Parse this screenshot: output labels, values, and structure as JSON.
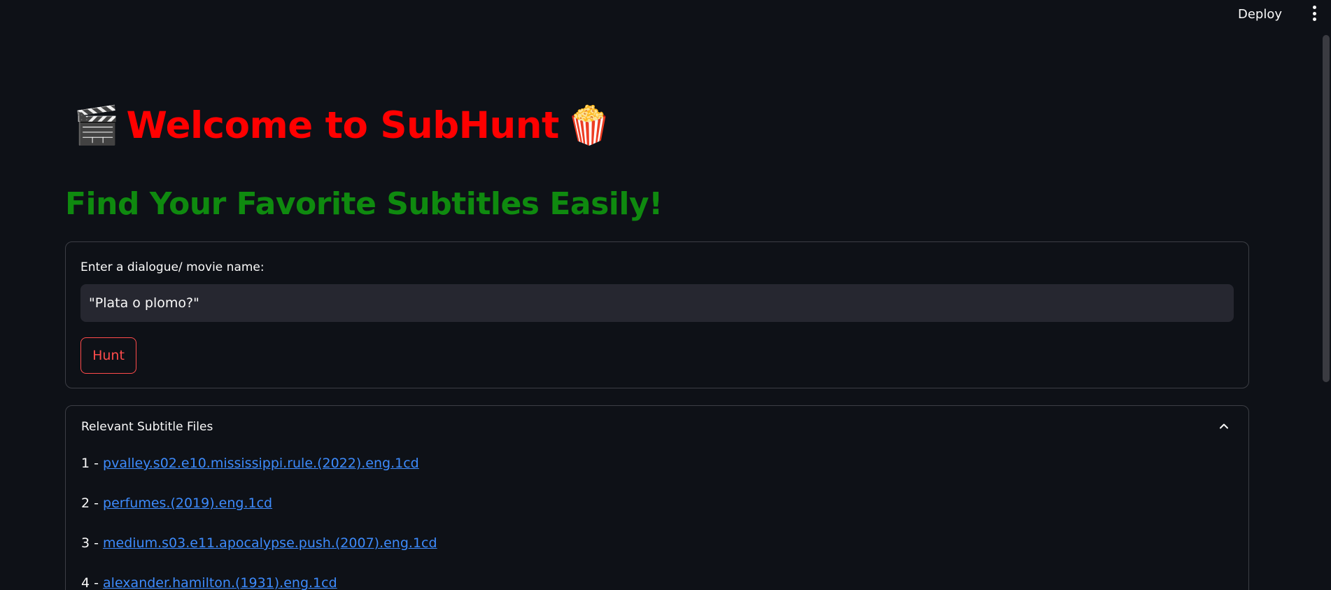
{
  "header": {
    "deploy_label": "Deploy"
  },
  "title": {
    "leading_emoji": "🎬",
    "text": "Welcome to SubHunt",
    "trailing_emoji": "🍿",
    "color": "#ff0000"
  },
  "subtitle": {
    "text": "Find Your Favorite Subtitles Easily!",
    "color": "#0f8a0f"
  },
  "search_form": {
    "label": "Enter a dialogue/ movie name:",
    "input_value": "\"Plata o plomo?\"",
    "button_label": "Hunt",
    "accent_color": "#ff4b4b"
  },
  "results": {
    "header": "Relevant Subtitle Files",
    "expanded": true,
    "link_color": "#3d8bfd",
    "items": [
      {
        "prefix": "1 - ",
        "name": "pvalley.s02.e10.mississippi.rule.(2022).eng.1cd"
      },
      {
        "prefix": "2 - ",
        "name": "perfumes.(2019).eng.1cd"
      },
      {
        "prefix": "3 - ",
        "name": "medium.s03.e11.apocalypse.push.(2007).eng.1cd"
      },
      {
        "prefix": "4 - ",
        "name": "alexander.hamilton.(1931).eng.1cd"
      }
    ]
  },
  "icons": {
    "menu": "vertical-dots-icon",
    "collapse": "chevron-up-icon"
  }
}
